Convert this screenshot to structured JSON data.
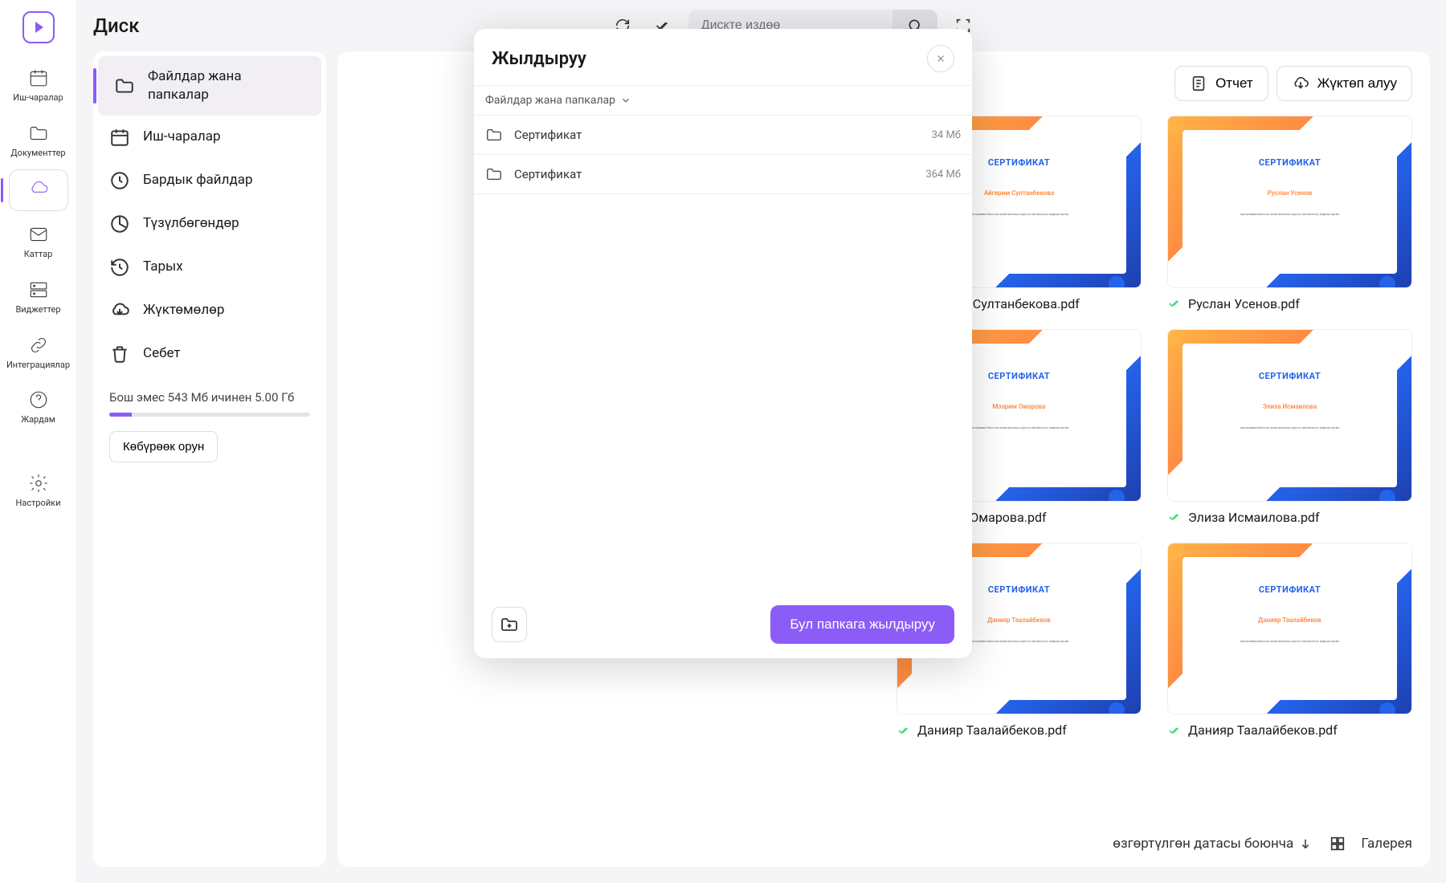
{
  "app_title": "Диск",
  "left_nav": [
    {
      "label": "Иш-чаралар",
      "icon": "calendar"
    },
    {
      "label": "Документтер",
      "icon": "folder"
    },
    {
      "label": "",
      "icon": "cloud",
      "active": true
    },
    {
      "label": "Каттар",
      "icon": "mail"
    },
    {
      "label": "Виджеттер",
      "icon": "server"
    },
    {
      "label": "Интеграциялар",
      "icon": "link"
    },
    {
      "label": "Жардам",
      "icon": "help"
    }
  ],
  "left_nav_bottom": {
    "label": "Настройки",
    "icon": "settings"
  },
  "search": {
    "placeholder": "Дискте издөө"
  },
  "secondary": [
    {
      "label": "Файлдар жана папкалар",
      "icon": "folder",
      "active": true
    },
    {
      "label": "Иш-чаралар",
      "icon": "calendar"
    },
    {
      "label": "Бардык файлдар",
      "icon": "clock"
    },
    {
      "label": "Түзүлбөгөндөр",
      "icon": "pie"
    },
    {
      "label": "Тарых",
      "icon": "history"
    },
    {
      "label": "Жүктөмөлөр",
      "icon": "download"
    },
    {
      "label": "Себет",
      "icon": "trash"
    }
  ],
  "storage": {
    "text": "Бош эмес 543 Мб ичинен 5.00 Гб",
    "more": "Көбүрөөк орун"
  },
  "header_buttons": {
    "report": "Отчет",
    "download": "Жүктөп алуу"
  },
  "files": [
    {
      "title": "СЕРТИФИКАТ",
      "person": "Айгерим Султанбекова",
      "filename": "Айгерим Султанбекова.pdf"
    },
    {
      "title": "СЕРТИФИКАТ",
      "person": "Руслан Усенов",
      "filename": "Руслан Усенов.pdf"
    },
    {
      "title": "СЕРТИФИКАТ",
      "person": "Мээрим Омарова",
      "filename": "Мээрим Омарова.pdf"
    },
    {
      "title": "СЕРТИФИКАТ",
      "person": "Элиза Исмаилова",
      "filename": "Элиза Исмаилова.pdf"
    },
    {
      "title": "СЕРТИФИКАТ",
      "person": "Данияр Таалайбеков",
      "filename": "Данияр Таалайбеков.pdf"
    },
    {
      "title": "СЕРТИФИКАТ",
      "person": "Данияр Таалайбеков",
      "filename": "Данияр Таалайбеков.pdf"
    }
  ],
  "cert_body": "программа боюнча практикалык курсту ийгиликтүү өздөштүргөн",
  "footer": {
    "sort": "өзгөртүлгөн датасы боюнча",
    "view": "Галерея"
  },
  "modal": {
    "title": "Жылдыруу",
    "breadcrumb": "Файлдар жана папкалар",
    "rows": [
      {
        "name": "Сертификат",
        "size": "34 Мб"
      },
      {
        "name": "Сертификат",
        "size": "364 Мб"
      }
    ],
    "action": "Бул папкага жылдыруу"
  }
}
